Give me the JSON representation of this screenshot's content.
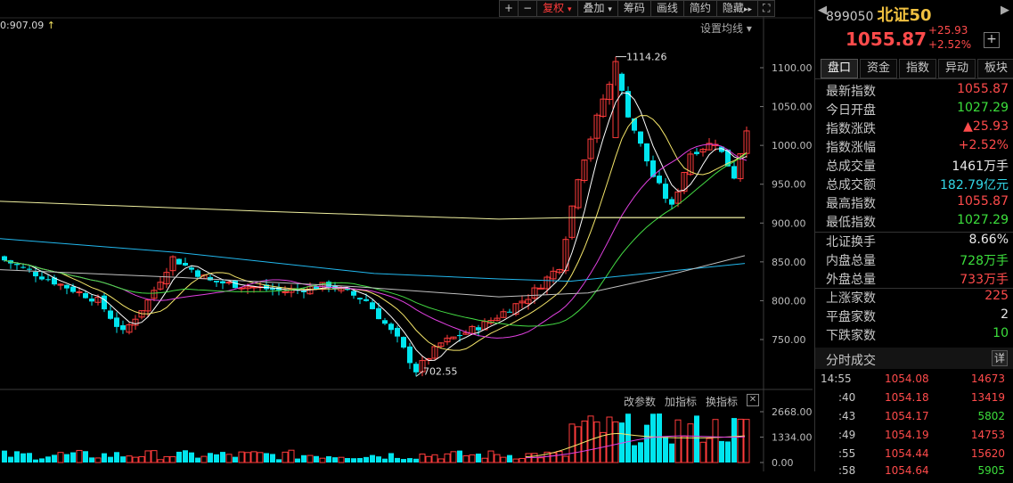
{
  "toolbar": {
    "plus_label": "+",
    "minus_label": "−",
    "fuquan_label": "复权",
    "overlay_label": "叠加",
    "chips_label": "筹码",
    "draw_label": "画线",
    "simple_label": "简约",
    "hide_label": "隐藏",
    "hide_glyph": "▸▸",
    "fullscreen_label": "⛶"
  },
  "chart_top": {
    "ma_text": "0:907.09",
    "ma_arrow": "↑",
    "set_ma_label": "设置均线 ▾"
  },
  "chart_data": {
    "type": "candlestick",
    "y_ticks": [
      "1100.00",
      "1050.00",
      "1000.00",
      "950.00",
      "900.00",
      "850.00",
      "800.00",
      "750.00"
    ],
    "y_values": [
      1100,
      1050,
      1000,
      950,
      900,
      850,
      800,
      750
    ],
    "ylim": [
      695,
      1120
    ],
    "high_label": "1114.26",
    "low_label": "702.55",
    "volume_ticks": [
      "2668.00",
      "1334.00",
      "0.00"
    ],
    "volume_values": [
      2668,
      1334,
      0
    ],
    "volume_ylim": [
      0,
      2900
    ],
    "reference_level": 907.09
  },
  "sub_chart": {
    "modify_params": "改参数",
    "add_indicator": "加指标",
    "switch_indicator": "换指标",
    "close_glyph": "✕"
  },
  "panel": {
    "nav_left": "◀",
    "nav_right": "▶",
    "code": "899050",
    "name": "北证50",
    "price": "1055.87",
    "change": "+25.93",
    "change_pct": "+2.52%",
    "add_glyph": "+",
    "tabs": [
      "盘口",
      "资金",
      "指数",
      "异动",
      "板块"
    ],
    "rows": [
      {
        "k": "最新指数",
        "v": "1055.87"
      },
      {
        "k": "今日开盘",
        "v": "1027.29"
      },
      {
        "k": "指数涨跌",
        "v": "▲25.93"
      },
      {
        "k": "指数涨幅",
        "v": "+2.52%"
      },
      {
        "k": "总成交量",
        "v": "1461",
        "unit": "万手"
      },
      {
        "k": "总成交额",
        "v": "182.79",
        "unit": "亿元"
      },
      {
        "k": "最高指数",
        "v": "1055.87"
      },
      {
        "k": "最低指数",
        "v": "1027.29"
      },
      {
        "k": "北证换手",
        "v": "8.66%"
      },
      {
        "k": "内盘总量",
        "v": "728",
        "unit": "万手"
      },
      {
        "k": "外盘总量",
        "v": "733",
        "unit": "万手"
      },
      {
        "k": "上涨家数",
        "v": "225"
      },
      {
        "k": "平盘家数",
        "v": "2"
      },
      {
        "k": "下跌家数",
        "v": "10"
      }
    ],
    "ticks_title": "分时成交",
    "ticks_more": "详",
    "ticks": [
      {
        "t": "14:55",
        "p": "1054.08",
        "q": "14673"
      },
      {
        "t": ":40",
        "p": "1054.18",
        "q": "13419"
      },
      {
        "t": ":43",
        "p": "1054.17",
        "q": "5802"
      },
      {
        "t": ":49",
        "p": "1054.19",
        "q": "14753"
      },
      {
        "t": ":55",
        "p": "1054.44",
        "q": "15620"
      },
      {
        "t": ":58",
        "p": "1054.64",
        "q": "5905"
      }
    ]
  },
  "colors": {
    "up": "#ff3b3b",
    "down": "#00e5ee",
    "ma5": "#ffffff",
    "ma10": "#f5e66a",
    "ma20": "#e040e0",
    "ma30": "#44dd44",
    "ma60": "#22b8ee",
    "ma120": "#c0c0c0",
    "ma250": "#f0f0a0"
  }
}
